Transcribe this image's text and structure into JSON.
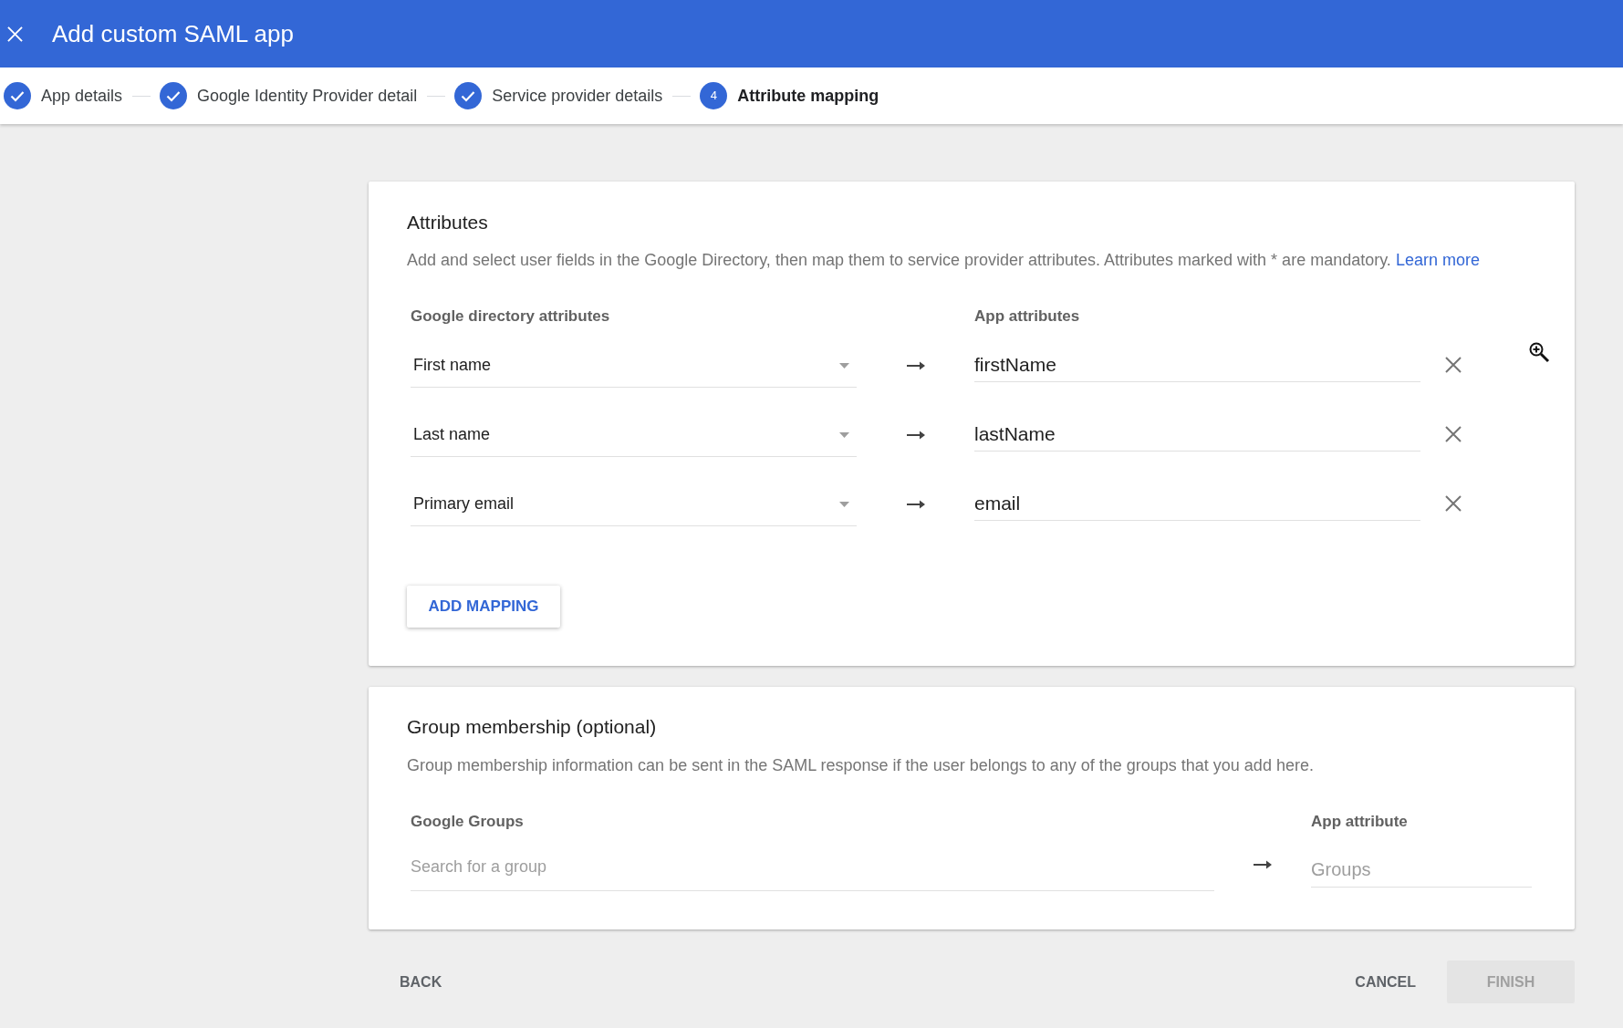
{
  "header": {
    "title": "Add custom SAML app"
  },
  "stepper": {
    "steps": [
      {
        "label": "App details",
        "completed": true,
        "selected": false
      },
      {
        "label": "Google Identity Provider detail",
        "completed": true,
        "selected": false
      },
      {
        "label": "Service provider details",
        "completed": true,
        "selected": false
      },
      {
        "label": "Attribute mapping",
        "number": "4",
        "completed": false,
        "selected": true
      }
    ]
  },
  "attributes": {
    "title": "Attributes",
    "description": "Add and select user fields in the Google Directory, then map them to service provider attributes. Attributes marked with * are mandatory.",
    "learn_more": "Learn more",
    "columns": [
      "Google directory attributes",
      "App attributes"
    ],
    "mappings": [
      {
        "directory_attribute": "First name",
        "app_attribute": "firstName"
      },
      {
        "directory_attribute": "Last name",
        "app_attribute": "lastName"
      },
      {
        "directory_attribute": "Primary email",
        "app_attribute": "email"
      }
    ],
    "add_button": "ADD MAPPING"
  },
  "group_membership": {
    "title": "Group membership (optional)",
    "description": "Group membership information can be sent in the SAML response if the user belongs to any of the groups that you add here.",
    "columns": [
      "Google Groups",
      "App attribute"
    ],
    "group_search": {
      "placeholder": "Search for a group"
    },
    "app_attribute": {
      "placeholder": "Groups"
    }
  },
  "footer": {
    "back": "BACK",
    "cancel": "CANCEL",
    "finish": {
      "label": "FINISH",
      "disabled": true
    }
  }
}
